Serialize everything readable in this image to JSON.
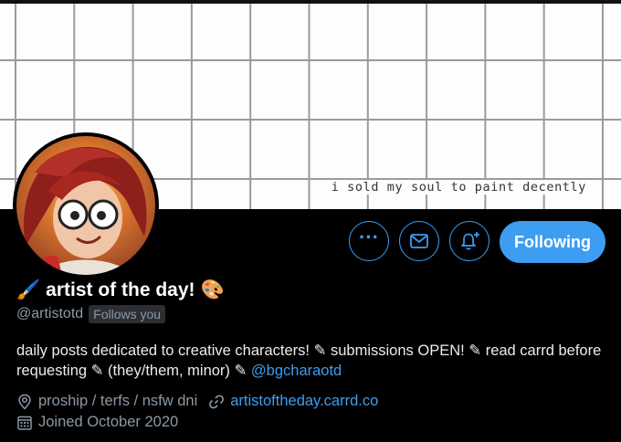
{
  "banner": {
    "caption": "i sold my soul to paint decently"
  },
  "actions": {
    "more_label": "···",
    "following_label": "Following"
  },
  "profile": {
    "name": "artist of the day!",
    "name_emoji_left": "🖌️",
    "name_emoji_right": "🎨",
    "handle": "@artistotd",
    "follows_you": "Follows you",
    "bio_text": "daily posts dedicated to creative characters! ✎ submissions OPEN! ✎ read carrd before requesting ✎ (they/them, minor) ✎ ",
    "bio_mention": "@bgcharaotd",
    "location": "proship / terfs / nsfw dni",
    "website": "artistoftheday.carrd.co",
    "joined": "Joined October 2020"
  },
  "colors": {
    "accent": "#3d9df0",
    "background": "#000000",
    "muted": "#8b98a5"
  },
  "icons": [
    "more-icon",
    "mail-icon",
    "bell-plus-icon",
    "location-pin-icon",
    "link-icon",
    "calendar-icon"
  ]
}
